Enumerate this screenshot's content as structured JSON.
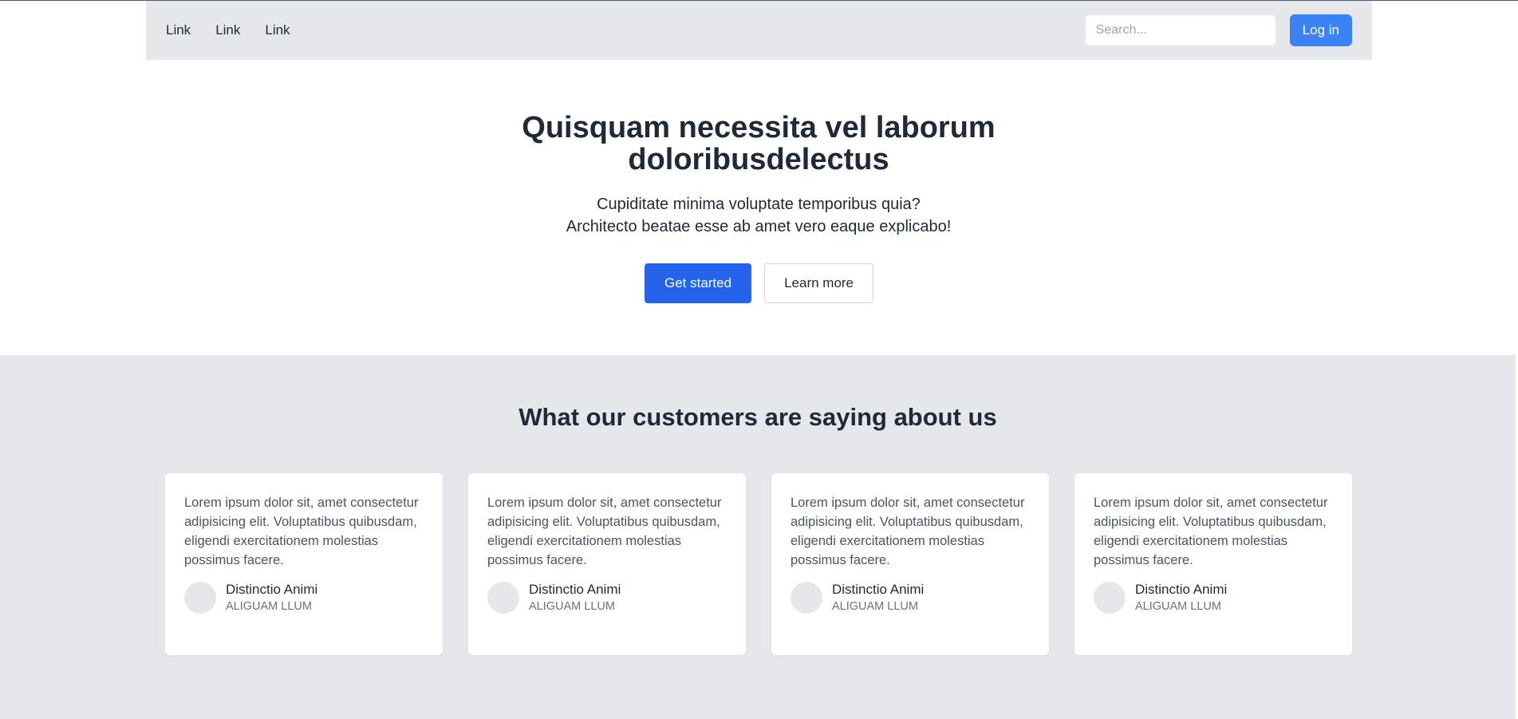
{
  "nav": {
    "links": [
      "Link",
      "Link",
      "Link"
    ],
    "search_placeholder": "Search...",
    "login_label": "Log in"
  },
  "hero": {
    "title_line1": "Quisquam necessita vel laborum",
    "title_line2": "doloribusdelectus",
    "subtitle_line1": "Cupiditate minima voluptate temporibus quia?",
    "subtitle_line2": "Architecto beatae esse ab amet vero eaque explicabo!",
    "primary_label": "Get started",
    "secondary_label": "Learn more"
  },
  "testimonials": {
    "title": "What our customers are saying about us",
    "cards": [
      {
        "quote": "Lorem ipsum dolor sit, amet consectetur adipisicing elit. Voluptatibus quibusdam, eligendi exercitationem molestias possimus facere.",
        "name": "Distinctio Animi",
        "role": "ALIGUAM LLUM"
      },
      {
        "quote": "Lorem ipsum dolor sit, amet consectetur adipisicing elit. Voluptatibus quibusdam, eligendi exercitationem molestias possimus facere.",
        "name": "Distinctio Animi",
        "role": "ALIGUAM LLUM"
      },
      {
        "quote": "Lorem ipsum dolor sit, amet consectetur adipisicing elit. Voluptatibus quibusdam, eligendi exercitationem molestias possimus facere.",
        "name": "Distinctio Animi",
        "role": "ALIGUAM LLUM"
      },
      {
        "quote": "Lorem ipsum dolor sit, amet consectetur adipisicing elit. Voluptatibus quibusdam, eligendi exercitationem molestias possimus facere.",
        "name": "Distinctio Animi",
        "role": "ALIGUAM LLUM"
      }
    ]
  },
  "colors": {
    "accent": "#3b82f6",
    "primary": "#2563eb",
    "surface": "#e5e7eb",
    "text": "#1f2937"
  }
}
